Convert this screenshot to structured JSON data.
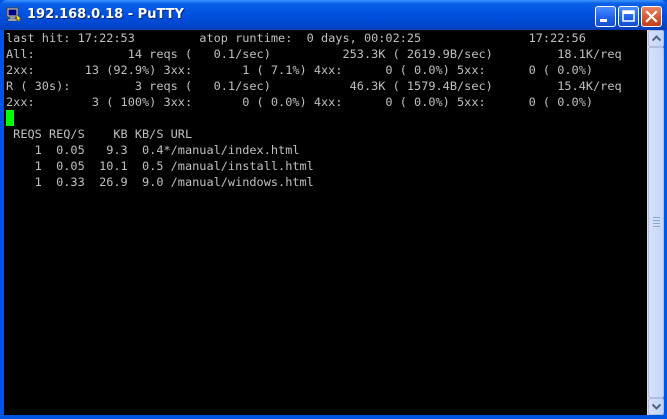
{
  "window": {
    "title": "192.168.0.18 - PuTTY",
    "icon": "putty-terminal-icon",
    "controls": [
      "minimize-icon",
      "maximize-icon",
      "close-icon"
    ]
  },
  "terminal": {
    "lines": [
      "last hit: 17:22:53         atop runtime:  0 days, 00:02:25               17:22:56",
      "All:             14 reqs (   0.1/sec)          253.3K ( 2619.9B/sec)         18.1K/req",
      "2xx:       13 (92.9%) 3xx:       1 ( 7.1%) 4xx:      0 ( 0.0%) 5xx:      0 ( 0.0%)",
      "R ( 30s):         3 reqs (   0.1/sec)           46.3K ( 1579.4B/sec)         15.4K/req",
      "2xx:        3 ( 100%) 3xx:       0 ( 0.0%) 4xx:      0 ( 0.0%) 5xx:      0 ( 0.0%)",
      "",
      " REQS REQ/S    KB KB/S URL",
      "    1  0.05   9.3  0.4*/manual/index.html",
      "    1  0.05  10.1  0.5 /manual/install.html",
      "    1  0.33  26.9  9.0 /manual/windows.html"
    ],
    "cursor_color": "#00ff00",
    "text_color": "#c0c0c0",
    "background_color": "#000000"
  },
  "colors": {
    "titlebar": "#0054e3",
    "close_button": "#d2532f"
  }
}
